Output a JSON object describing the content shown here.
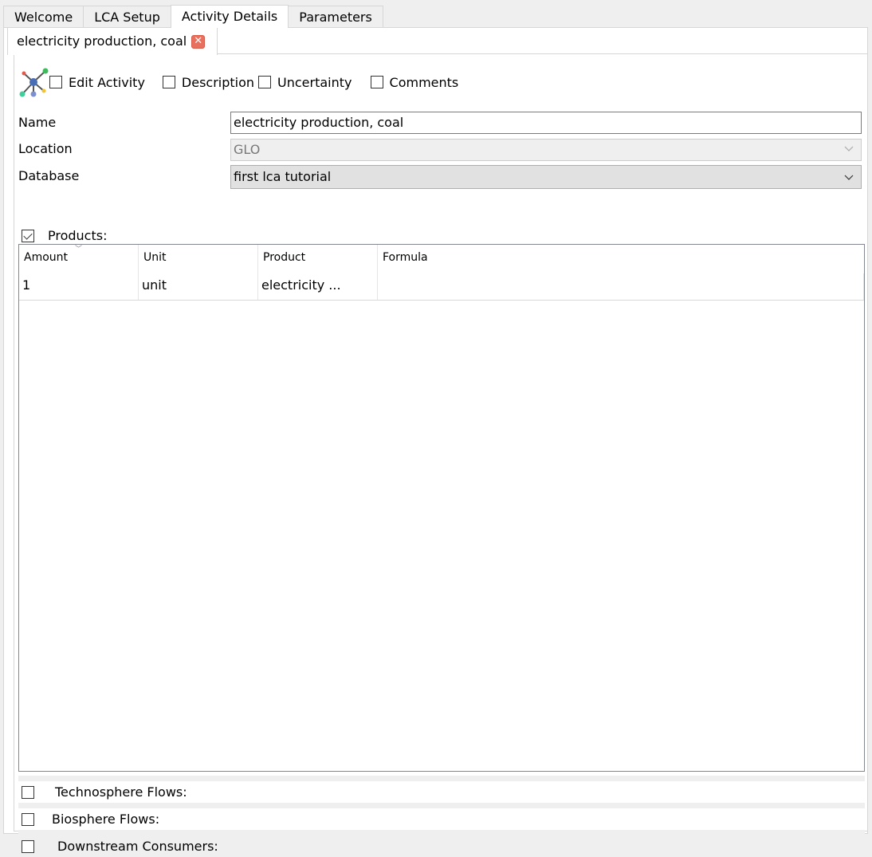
{
  "outer_tabs": [
    {
      "label": "Welcome",
      "active": false
    },
    {
      "label": "LCA Setup",
      "active": false
    },
    {
      "label": "Activity Details",
      "active": true
    },
    {
      "label": "Parameters",
      "active": false
    }
  ],
  "activity_tab": {
    "label": "electricity production, coal",
    "close_icon": "close-icon",
    "close_color": "#e8705e"
  },
  "toolbar": {
    "icon": "graph-network-icon",
    "checkboxes": [
      {
        "label": "Edit Activity",
        "checked": false
      },
      {
        "label": "Description",
        "checked": false
      },
      {
        "label": "Uncertainty",
        "checked": false
      },
      {
        "label": "Comments",
        "checked": false
      }
    ]
  },
  "form": {
    "name_label": "Name",
    "name_value": "electricity production, coal",
    "location_label": "Location",
    "location_value": "GLO",
    "database_label": "Database",
    "database_value": "first lca tutorial"
  },
  "products": {
    "label": "Products:",
    "checked": true,
    "columns": [
      "Amount",
      "Unit",
      "Product",
      "Formula"
    ],
    "rows": [
      {
        "amount": "1",
        "unit": "unit",
        "product": "electricity ...",
        "formula": ""
      }
    ]
  },
  "sections": [
    {
      "label": "Technosphere Flows:",
      "checked": false
    },
    {
      "label": "Biosphere Flows:",
      "checked": false
    },
    {
      "label": "Downstream Consumers:",
      "checked": false
    }
  ]
}
